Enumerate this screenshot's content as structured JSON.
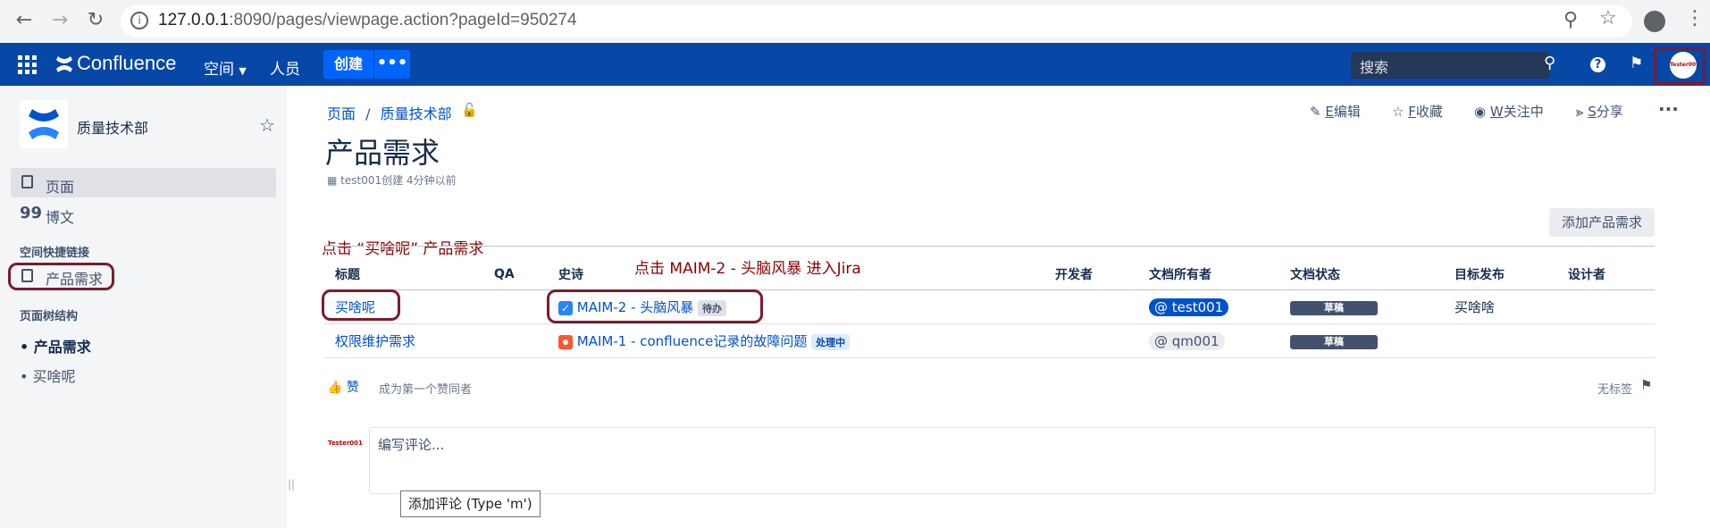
{
  "browser": {
    "url_host": "127.0.0.1",
    "url_path": ":8090/pages/viewpage.action?pageId=950274"
  },
  "header": {
    "logo_text": "Confluence",
    "spaces": "空间",
    "people": "人员",
    "create": "创建",
    "more": "•••",
    "search_placeholder": "搜索",
    "avatar_text": "Tester001"
  },
  "sidebar": {
    "space_name": "质量技术部",
    "items": [
      {
        "label": "页面"
      },
      {
        "label": "博文"
      }
    ],
    "shortcuts_heading": "空间快捷链接",
    "shortcut": "产品需求",
    "tree_heading": "页面树结构",
    "tree": [
      "产品需求",
      "买啥呢"
    ]
  },
  "page": {
    "breadcrumb": [
      "页面",
      "质量技术部"
    ],
    "title": "产品需求",
    "meta": "test001创建 4分钟以前",
    "toolbar": {
      "edit_key": "E",
      "edit": "编辑",
      "save_key": "F",
      "save": "收藏",
      "watch_key": "W",
      "watch": "关注中",
      "share_key": "S",
      "share": "分享"
    },
    "add_requirement": "添加产品需求",
    "annotation_1": "点击 “买啥呢” 产品需求",
    "annotation_2": "点击 MAIM-2 - 头脑风暴 进入Jira"
  },
  "table": {
    "headers": [
      "标题",
      "QA",
      "史诗",
      "开发者",
      "文档所有者",
      "文档状态",
      "目标发布",
      "设计者"
    ],
    "rows": [
      {
        "title": "买啥呢",
        "qa": "",
        "epic": "MAIM-2 - 头脑风暴",
        "epic_status": "待办",
        "dev": "",
        "owner": "@ test001",
        "doc_status": "草稿",
        "release": "买啥啥",
        "designer": ""
      },
      {
        "title": "权限维护需求",
        "qa": "",
        "epic": "MAIM-1 - confluence记录的故障问题",
        "epic_status": "处理中",
        "dev": "",
        "owner": "@ qm001",
        "doc_status": "草稿",
        "release": "",
        "designer": ""
      }
    ]
  },
  "footer": {
    "like": "赞",
    "first_like": "成为第一个赞同者",
    "no_labels": "无标签",
    "commenter": "Tester001",
    "comment_placeholder": "编写评论...",
    "tooltip": "添加评论 (Type 'm')"
  },
  "colors": {
    "header_bg": "#0747a6",
    "create_btn": "#0065ff",
    "annotation_red": "#8b0000"
  }
}
